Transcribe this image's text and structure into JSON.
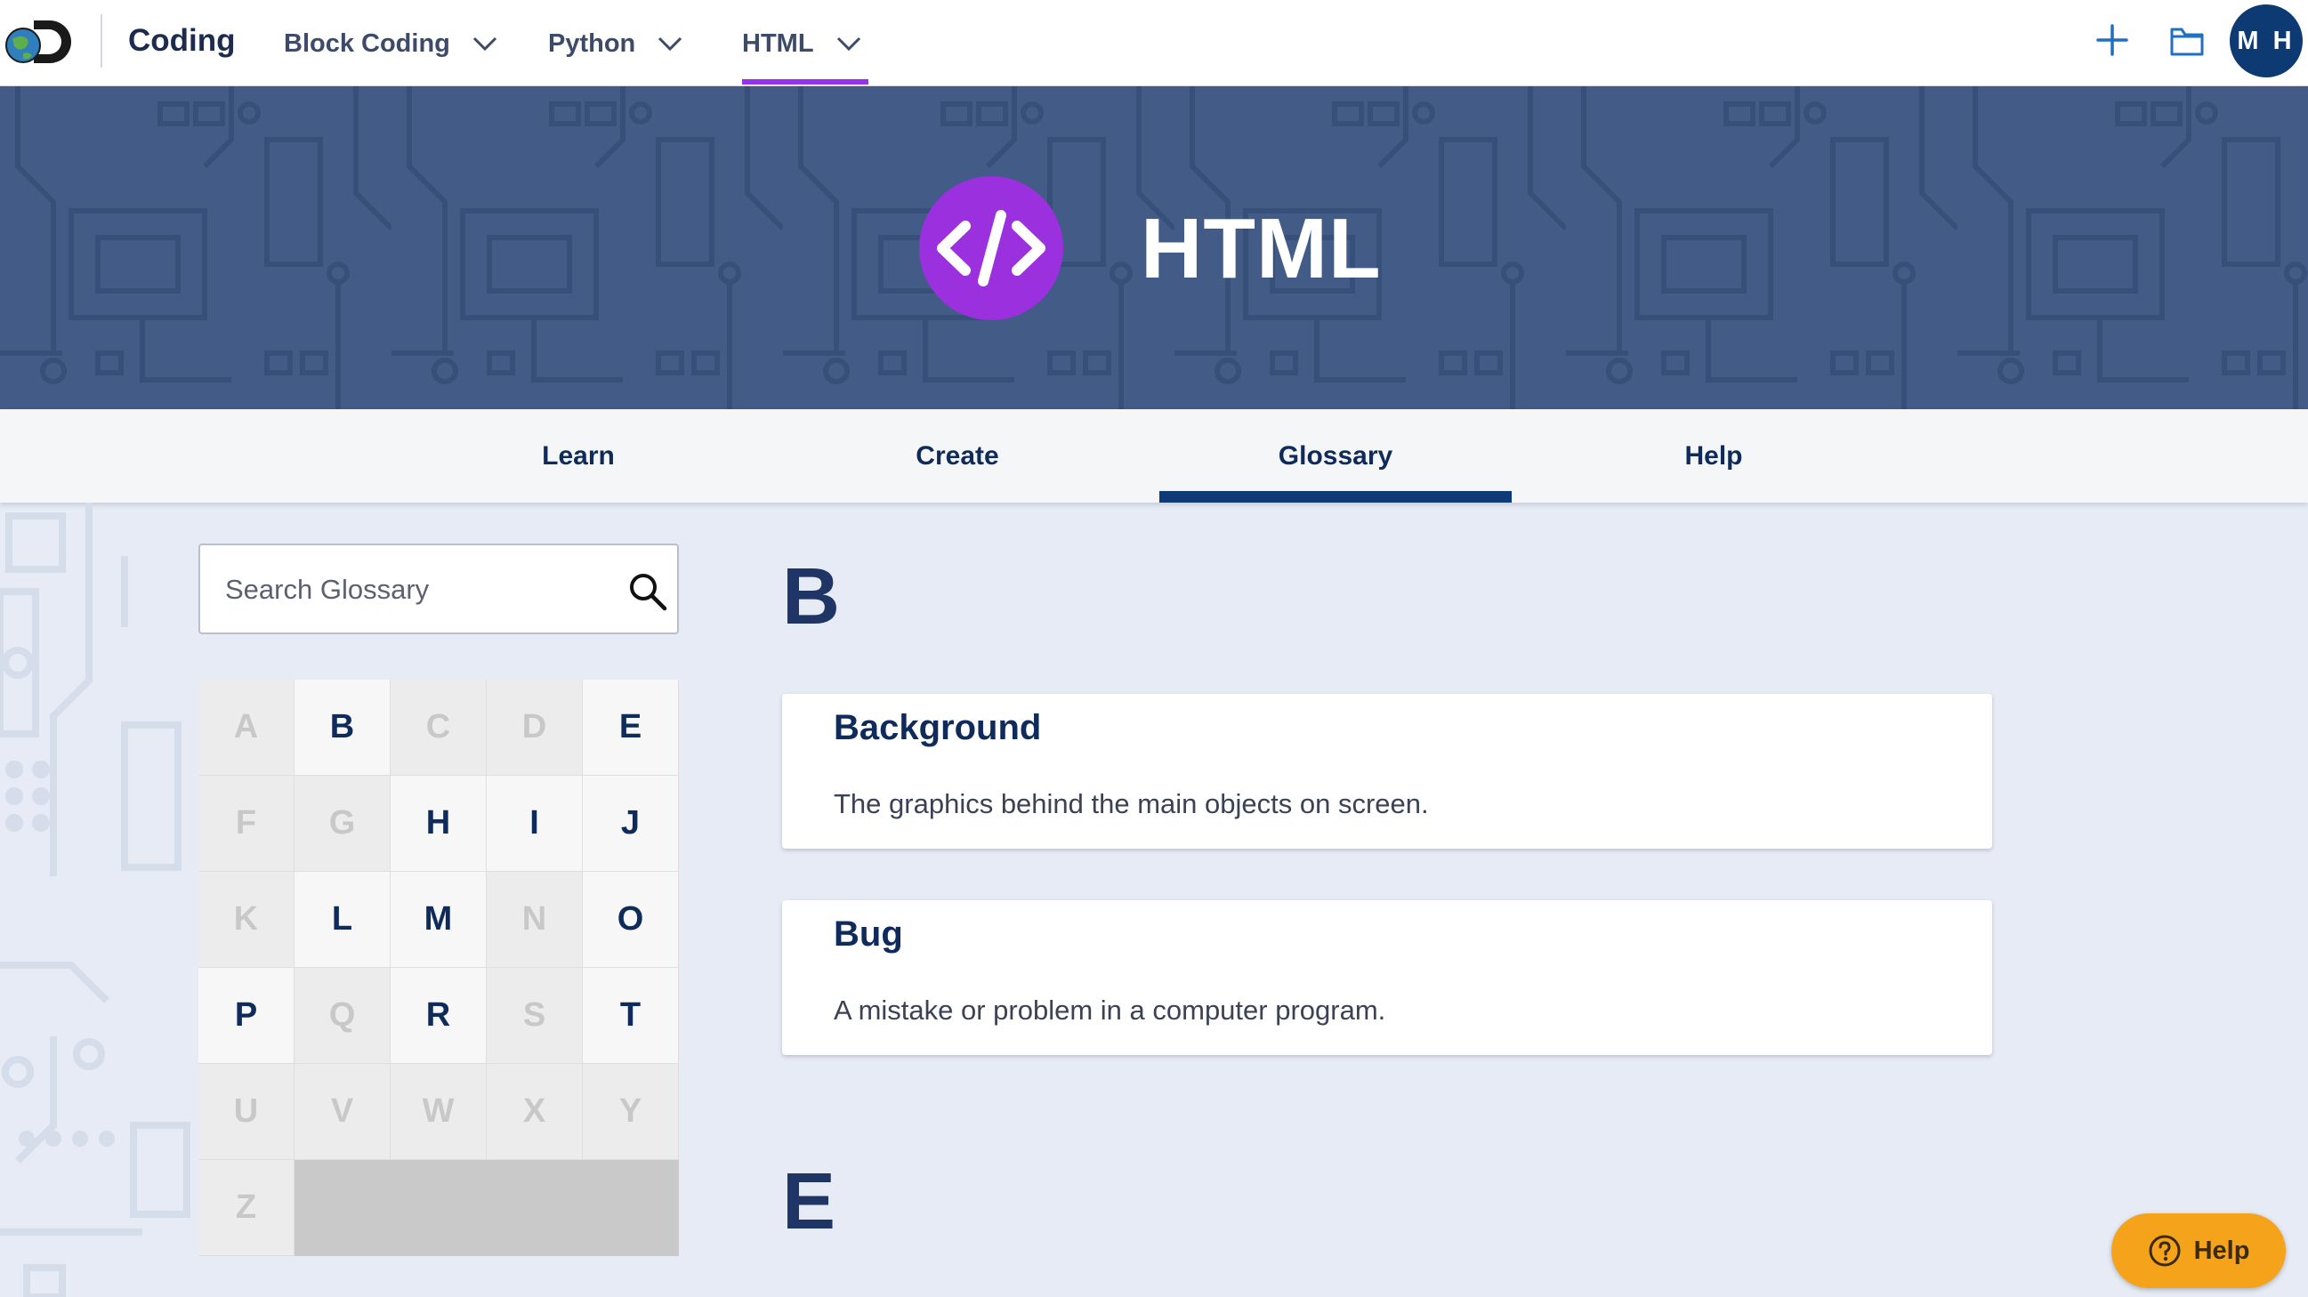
{
  "topnav": {
    "app_title": "Coding",
    "menu": [
      {
        "label": "Block Coding"
      },
      {
        "label": "Python"
      },
      {
        "label": "HTML"
      }
    ],
    "avatar_initials": "M H",
    "icons": [
      "discovery-logo",
      "plus-icon",
      "folder-icon",
      "chevron-down-icon"
    ]
  },
  "hero": {
    "title": "HTML",
    "badge_glyph": "</>",
    "icon": "code-icon"
  },
  "tabs": [
    {
      "label": "Learn"
    },
    {
      "label": "Create"
    },
    {
      "label": "Glossary",
      "active": true
    },
    {
      "label": "Help"
    }
  ],
  "search": {
    "placeholder": "Search Glossary",
    "icon": "search-icon"
  },
  "alphabet": {
    "letters": [
      "A",
      "B",
      "C",
      "D",
      "E",
      "F",
      "G",
      "H",
      "I",
      "J",
      "K",
      "L",
      "M",
      "N",
      "O",
      "P",
      "Q",
      "R",
      "S",
      "T",
      "U",
      "V",
      "W",
      "X",
      "Y",
      "Z"
    ],
    "active": [
      "B",
      "E",
      "H",
      "I",
      "J",
      "L",
      "M",
      "O",
      "P",
      "R",
      "T"
    ]
  },
  "glossary": {
    "sections": [
      {
        "letter": "B",
        "terms": [
          {
            "term": "Background",
            "definition": "The graphics behind the main objects on screen."
          },
          {
            "term": "Bug",
            "definition": "A mistake or problem in a computer program."
          }
        ]
      },
      {
        "letter": "E",
        "terms": []
      }
    ]
  },
  "help_button": {
    "label": "Help",
    "icon": "question-circle-icon"
  },
  "colors": {
    "nav_accent": "#9333ea",
    "hero_bg": "#425b87",
    "badge_purple": "#9b30de",
    "tab_active": "#0e3a78",
    "help_orange": "#f5a31a",
    "avatar_bg": "#0d3a73"
  }
}
